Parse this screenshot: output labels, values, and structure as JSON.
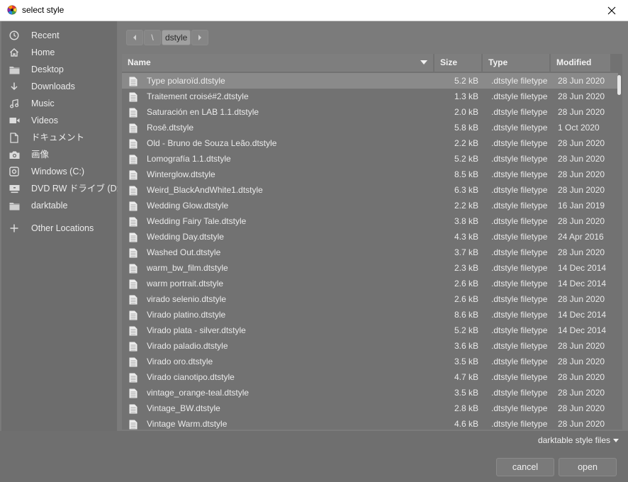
{
  "window": {
    "title": "select style"
  },
  "sidebar": {
    "items": [
      {
        "label": "Recent",
        "icon": "clock-icon"
      },
      {
        "label": "Home",
        "icon": "home-icon"
      },
      {
        "label": "Desktop",
        "icon": "folder-icon"
      },
      {
        "label": "Downloads",
        "icon": "download-icon"
      },
      {
        "label": "Music",
        "icon": "music-icon"
      },
      {
        "label": "Videos",
        "icon": "video-icon"
      },
      {
        "label": "ドキュメント",
        "icon": "document-icon"
      },
      {
        "label": "画像",
        "icon": "camera-icon"
      },
      {
        "label": "Windows (C:)",
        "icon": "drive-icon"
      },
      {
        "label": "DVD RW ドライブ (D:)",
        "icon": "optical-drive-icon"
      },
      {
        "label": "darktable",
        "icon": "folder-icon"
      }
    ],
    "other": {
      "label": "Other Locations",
      "icon": "plus-icon"
    }
  },
  "pathbar": {
    "root": "\\",
    "current": "dstyle"
  },
  "table": {
    "headers": {
      "name": "Name",
      "size": "Size",
      "type": "Type",
      "modified": "Modified"
    },
    "rows": [
      {
        "name": "Type polaroïd.dtstyle",
        "size": "5.2 kB",
        "type": ".dtstyle filetype",
        "modified": "28 Jun 2020"
      },
      {
        "name": "Traitement croisé#2.dtstyle",
        "size": "1.3 kB",
        "type": ".dtstyle filetype",
        "modified": "28 Jun 2020"
      },
      {
        "name": "Saturación en LAB 1.1.dtstyle",
        "size": "2.0 kB",
        "type": ".dtstyle filetype",
        "modified": "28 Jun 2020"
      },
      {
        "name": "Rosê.dtstyle",
        "size": "5.8 kB",
        "type": ".dtstyle filetype",
        "modified": "1 Oct 2020"
      },
      {
        "name": "Old - Bruno de Souza Leão.dtstyle",
        "size": "2.2 kB",
        "type": ".dtstyle filetype",
        "modified": "28 Jun 2020"
      },
      {
        "name": "Lomografía 1.1.dtstyle",
        "size": "5.2 kB",
        "type": ".dtstyle filetype",
        "modified": "28 Jun 2020"
      },
      {
        "name": "Winterglow.dtstyle",
        "size": "8.5 kB",
        "type": ".dtstyle filetype",
        "modified": "28 Jun 2020"
      },
      {
        "name": "Weird_BlackAndWhite1.dtstyle",
        "size": "6.3 kB",
        "type": ".dtstyle filetype",
        "modified": "28 Jun 2020"
      },
      {
        "name": "Wedding Glow.dtstyle",
        "size": "2.2 kB",
        "type": ".dtstyle filetype",
        "modified": "16 Jan 2019"
      },
      {
        "name": "Wedding Fairy Tale.dtstyle",
        "size": "3.8 kB",
        "type": ".dtstyle filetype",
        "modified": "28 Jun 2020"
      },
      {
        "name": "Wedding Day.dtstyle",
        "size": "4.3 kB",
        "type": ".dtstyle filetype",
        "modified": "24 Apr 2016"
      },
      {
        "name": "Washed Out.dtstyle",
        "size": "3.7 kB",
        "type": ".dtstyle filetype",
        "modified": "28 Jun 2020"
      },
      {
        "name": "warm_bw_film.dtstyle",
        "size": "2.3 kB",
        "type": ".dtstyle filetype",
        "modified": "14 Dec 2014"
      },
      {
        "name": "warm portrait.dtstyle",
        "size": "2.6 kB",
        "type": ".dtstyle filetype",
        "modified": "14 Dec 2014"
      },
      {
        "name": "virado selenio.dtstyle",
        "size": "2.6 kB",
        "type": ".dtstyle filetype",
        "modified": "28 Jun 2020"
      },
      {
        "name": "Virado platino.dtstyle",
        "size": "8.6 kB",
        "type": ".dtstyle filetype",
        "modified": "14 Dec 2014"
      },
      {
        "name": "Virado plata - silver.dtstyle",
        "size": "5.2 kB",
        "type": ".dtstyle filetype",
        "modified": "14 Dec 2014"
      },
      {
        "name": "Virado paladio.dtstyle",
        "size": "3.6 kB",
        "type": ".dtstyle filetype",
        "modified": "28 Jun 2020"
      },
      {
        "name": "Virado oro.dtstyle",
        "size": "3.5 kB",
        "type": ".dtstyle filetype",
        "modified": "28 Jun 2020"
      },
      {
        "name": "Virado cianotipo.dtstyle",
        "size": "4.7 kB",
        "type": ".dtstyle filetype",
        "modified": "28 Jun 2020"
      },
      {
        "name": "vintage_orange-teal.dtstyle",
        "size": "3.5 kB",
        "type": ".dtstyle filetype",
        "modified": "28 Jun 2020"
      },
      {
        "name": "Vintage_BW.dtstyle",
        "size": "2.8 kB",
        "type": ".dtstyle filetype",
        "modified": "28 Jun 2020"
      },
      {
        "name": "Vintage Warm.dtstyle",
        "size": "4.6 kB",
        "type": ".dtstyle filetype",
        "modified": "28 Jun 2020"
      }
    ],
    "selected_index": 0
  },
  "footer": {
    "filter_label": "darktable style files",
    "cancel_label": "cancel",
    "open_label": "open"
  }
}
